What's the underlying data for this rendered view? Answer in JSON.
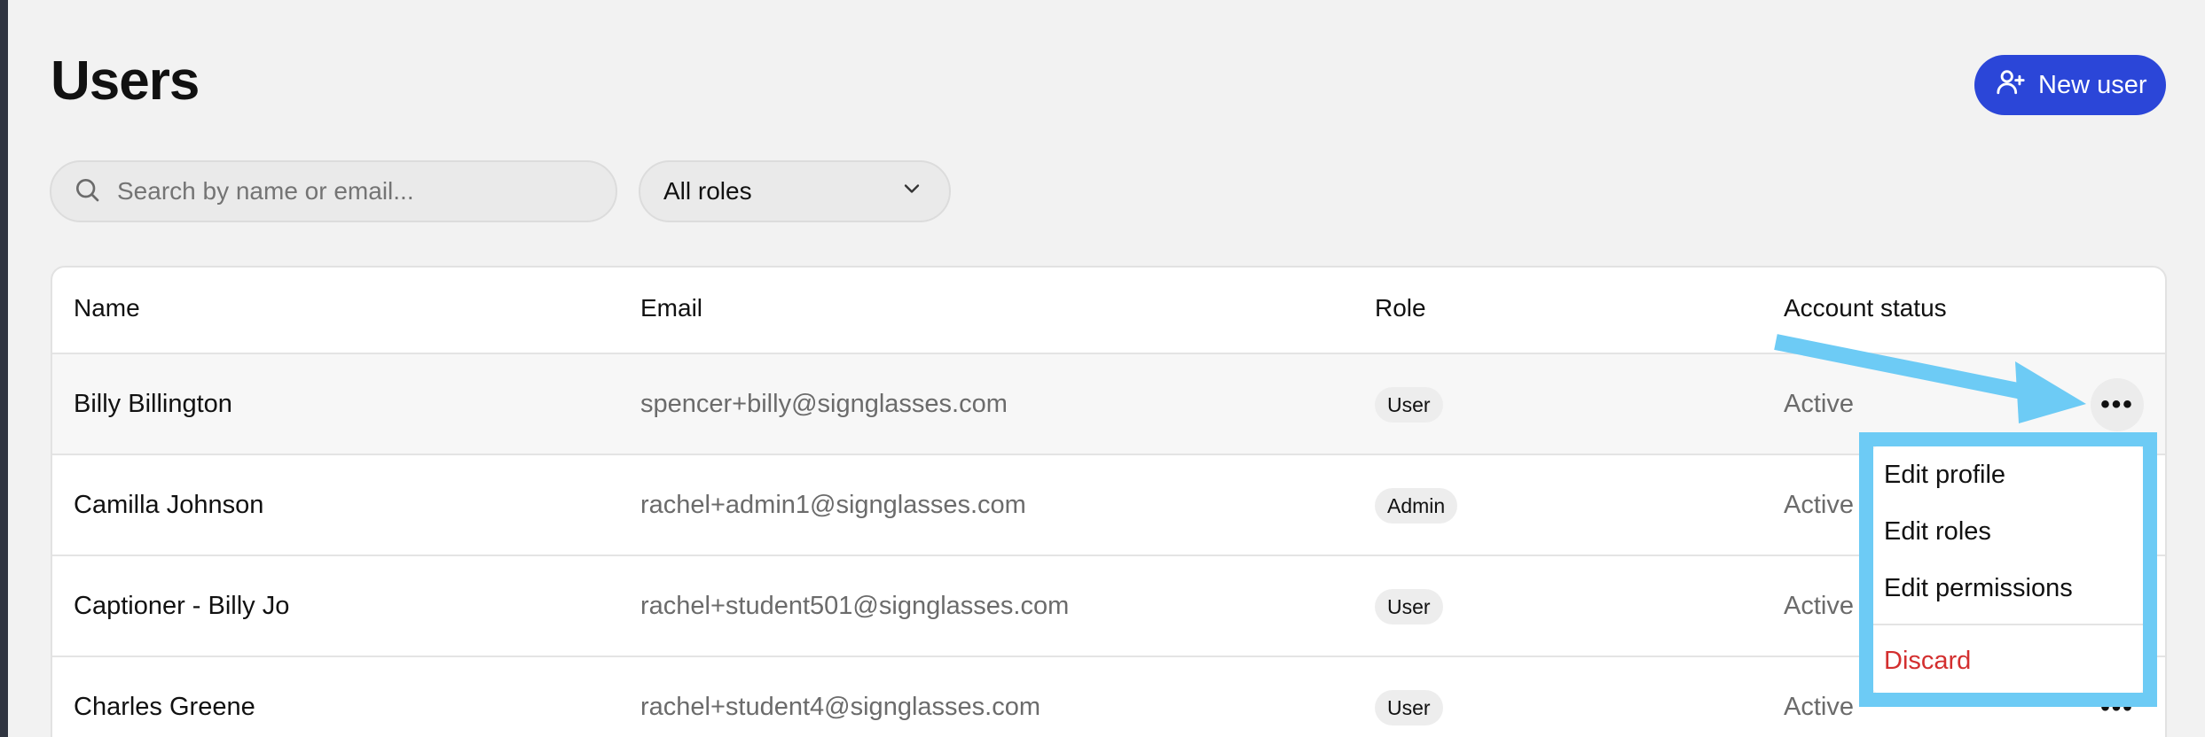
{
  "page": {
    "title": "Users"
  },
  "header": {
    "new_user_label": "New user"
  },
  "filters": {
    "search_placeholder": "Search by name or email...",
    "role_selected": "All roles"
  },
  "table": {
    "columns": [
      "Name",
      "Email",
      "Role",
      "Account status"
    ],
    "rows": [
      {
        "name": "Billy Billington",
        "email": "spencer+billy@signglasses.com",
        "role": "User",
        "status": "Active"
      },
      {
        "name": "Camilla Johnson",
        "email": "rachel+admin1@signglasses.com",
        "role": "Admin",
        "status": "Active"
      },
      {
        "name": "Captioner - Billy Jo",
        "email": "rachel+student501@signglasses.com",
        "role": "User",
        "status": "Active"
      },
      {
        "name": "Charles Greene",
        "email": "rachel+student4@signglasses.com",
        "role": "User",
        "status": "Active"
      }
    ],
    "row_actions_glyph": "•••"
  },
  "row_menu": {
    "items": [
      "Edit profile",
      "Edit roles",
      "Edit permissions"
    ],
    "danger_item": "Discard"
  },
  "colors": {
    "accent": "#2b46d8",
    "annotation": "#6dcbf5",
    "danger": "#d32f2f"
  },
  "icons": [
    "user-plus-icon",
    "search-icon",
    "chevron-down-icon",
    "more-horizontal-icon"
  ]
}
